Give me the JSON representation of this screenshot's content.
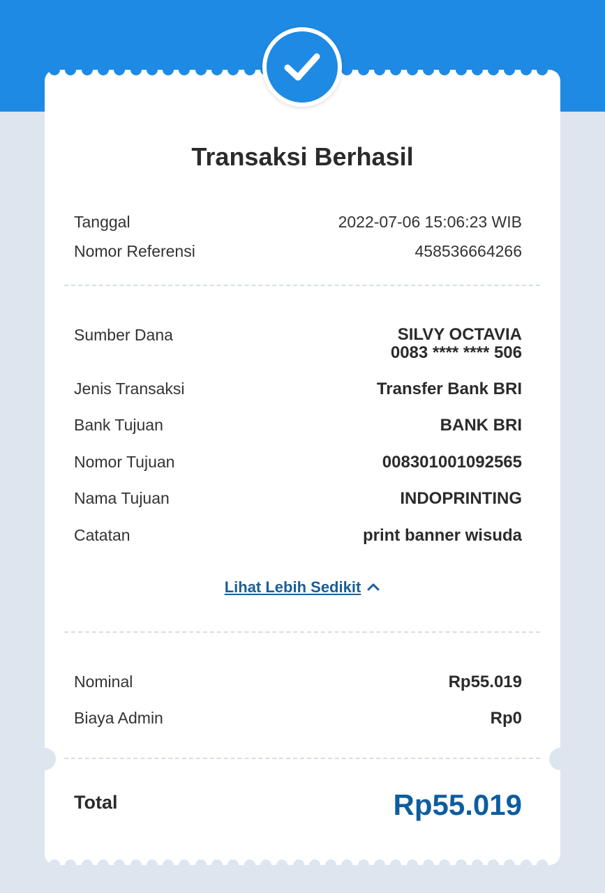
{
  "theme": {
    "accent": "#1e8ae3",
    "background": "#dde5ee",
    "link": "#1a5e96",
    "total": "#0e5d9e"
  },
  "status_icon": "check-icon",
  "title": "Transaksi Berhasil",
  "meta": {
    "date_label": "Tanggal",
    "date_value": "2022-07-06 15:06:23 WIB",
    "ref_label": "Nomor Referensi",
    "ref_value": "458536664266"
  },
  "details": {
    "source_label": "Sumber Dana",
    "source_name": "SILVY OCTAVIA",
    "source_account": "0083 **** **** 506",
    "type_label": "Jenis Transaksi",
    "type_value": "Transfer Bank BRI",
    "bank_label": "Bank Tujuan",
    "bank_value": "BANK BRI",
    "number_label": "Nomor Tujuan",
    "number_value": "008301001092565",
    "name_label": "Nama Tujuan",
    "name_value": "INDOPRINTING",
    "note_label": "Catatan",
    "note_value": "print banner wisuda"
  },
  "toggle": {
    "label": "Lihat Lebih Sedikit",
    "icon": "chevron-up-icon"
  },
  "amounts": {
    "nominal_label": "Nominal",
    "nominal_value": "Rp55.019",
    "admin_label": "Biaya Admin",
    "admin_value": "Rp0"
  },
  "total": {
    "label": "Total",
    "value": "Rp55.019"
  }
}
